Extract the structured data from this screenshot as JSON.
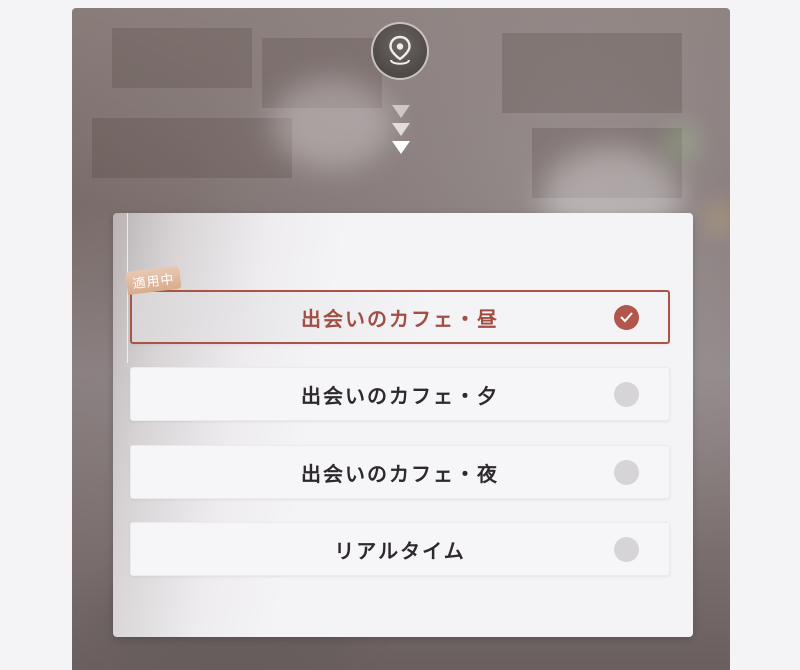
{
  "icons": {
    "location": "location-pin-icon",
    "arrow": "triangle-down-icon",
    "check": "check-icon"
  },
  "badge": {
    "label": "適用中"
  },
  "options": [
    {
      "label": "出会いのカフェ・昼",
      "selected": true
    },
    {
      "label": "出会いのカフェ・夕",
      "selected": false
    },
    {
      "label": "出会いのカフェ・夜",
      "selected": false
    },
    {
      "label": "リアルタイム",
      "selected": false
    }
  ],
  "colors": {
    "accent": "#a85446",
    "radio_off": "#d6d4d7",
    "badge": "#dcb093"
  }
}
